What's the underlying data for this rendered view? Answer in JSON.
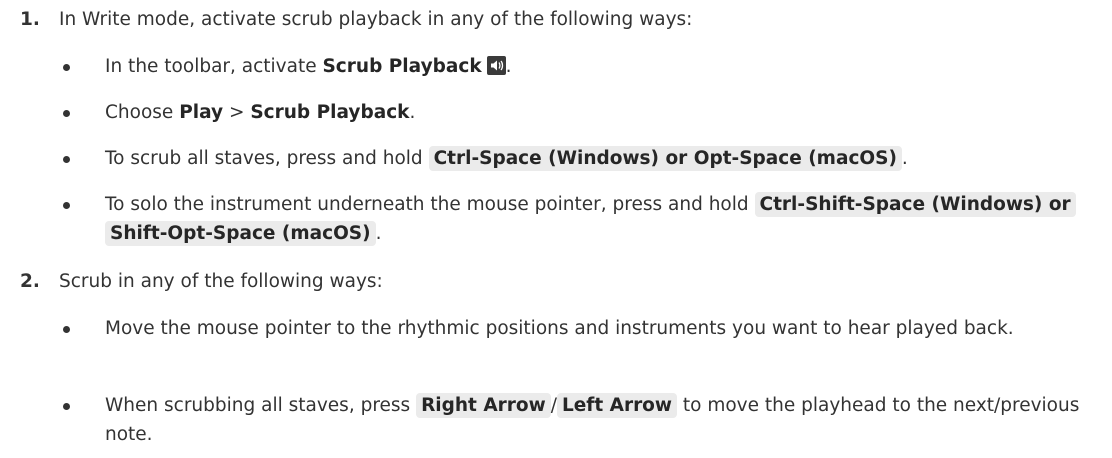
{
  "steps": [
    {
      "number": "1.",
      "text": "In Write mode, activate scrub playback in any of the following ways:",
      "bullets": [
        {
          "a": "In the toolbar, activate ",
          "b": "Scrub Playback",
          "icon": "speaker-icon",
          "c": "."
        },
        {
          "a": "Choose ",
          "b": "Play",
          "sep": " > ",
          "b2": "Scrub Playback",
          "c": "."
        },
        {
          "a": "To scrub all staves, press and hold ",
          "kbd": "Ctrl-Space (Windows) or Opt-Space (macOS)",
          "c": "."
        },
        {
          "a": "To solo the instrument underneath the mouse pointer, press and hold ",
          "kbd": "Ctrl-Shift-Space (Windows) or Shift-Opt-Space (macOS)",
          "c": "."
        }
      ]
    },
    {
      "number": "2.",
      "text": "Scrub in any of the following ways:",
      "bullets": [
        {
          "a": "Move the mouse pointer to the rhythmic positions and instruments you want to hear played back."
        },
        {
          "a": "When scrubbing all staves, press ",
          "kbd": "Right Arrow",
          "sep": "/",
          "kbd2": "Left Arrow",
          "c": " to move the playhead to the next/previous note."
        }
      ]
    }
  ]
}
